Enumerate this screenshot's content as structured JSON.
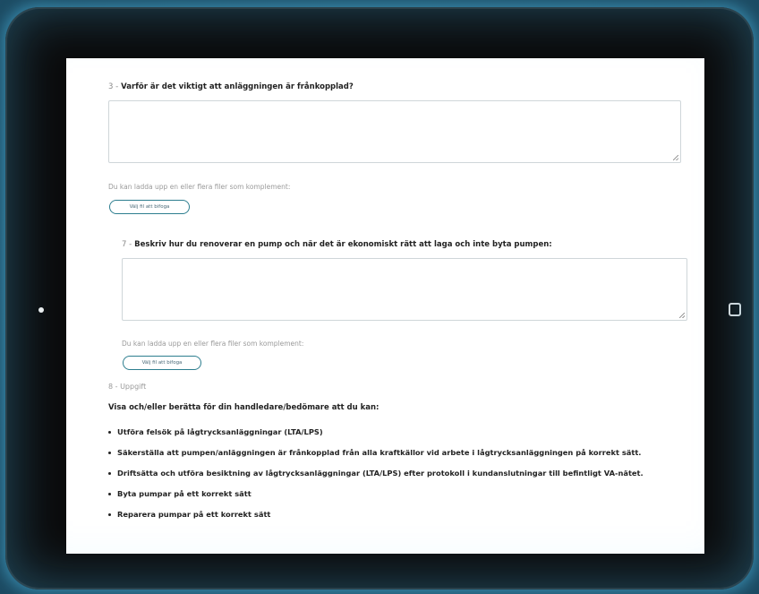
{
  "question3": {
    "number": "3 -",
    "title": "Varför är det viktigt att anläggningen är frånkopplad?",
    "answer_value": "",
    "upload_hint": "Du kan ladda upp en eller flera filer som komplement:",
    "file_button": "Välj fil att bifoga"
  },
  "question7": {
    "number": "7 -",
    "title": "Beskriv hur du renoverar en pump och när det är ekonomiskt rätt att laga och inte byta pumpen:",
    "answer_value": "",
    "upload_hint": "Du kan ladda upp en eller flera filer som komplement:",
    "file_button": "Välj fil att bifoga"
  },
  "task8": {
    "number": "8 -",
    "label": "Uppgift",
    "intro": "Visa och/eller berätta för din handledare/bedömare att du kan:",
    "items": [
      "Utföra felsök på lågtrycksanläggningar (LTA/LPS)",
      "Säkerställa att pumpen/anläggningen är frånkopplad från alla kraftkällor vid arbete i lågtrycksanläggningen på korrekt sätt.",
      "Driftsätta och utföra besiktning av lågtrycksanläggningar (LTA/LPS) efter protokoll i kundanslutningar till befintligt VA-nätet.",
      "Byta pumpar på ett korrekt sätt",
      "Reparera pumpar på ett korrekt sätt"
    ]
  },
  "colors": {
    "accent": "#2d7e8f",
    "bezel": "#0b0b0c",
    "glow": "#5ad2ff"
  },
  "icons": {
    "camera": "camera-dot-icon",
    "home": "home-button-icon",
    "resize": "resize-handle-icon"
  }
}
